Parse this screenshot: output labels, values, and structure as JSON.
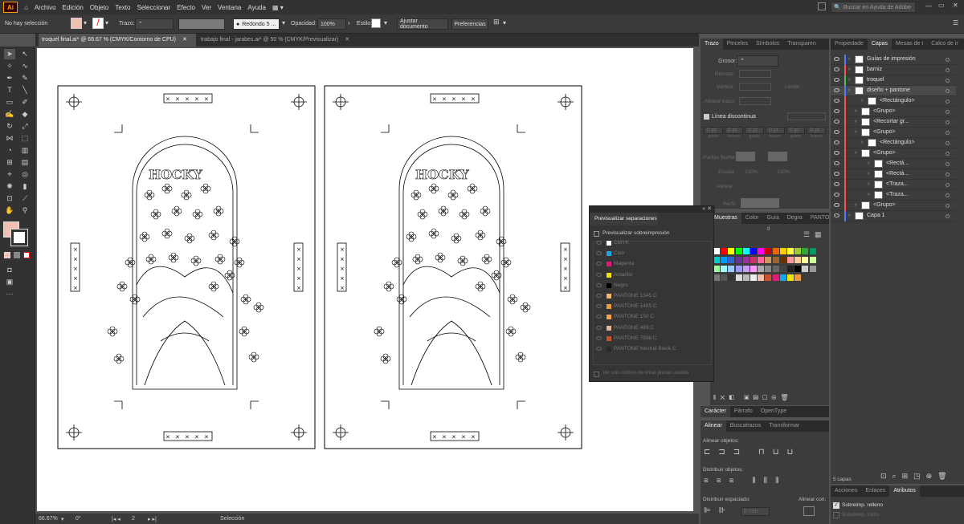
{
  "app": {
    "logo": "Ai",
    "search_placeholder": "Buscar en Ayuda de Adobe"
  },
  "menu": [
    "Archivo",
    "Edición",
    "Objeto",
    "Texto",
    "Seleccionar",
    "Efecto",
    "Ver",
    "Ventana",
    "Ayuda"
  ],
  "control": {
    "selection": "No hay selección",
    "stroke_label": "Trazo:",
    "brush": "Redondo 5 ...",
    "opacity_label": "Opacidad:",
    "opacity": "100%",
    "style_label": "Estilo:",
    "adjust_btn": "Ajustar documento",
    "prefs_btn": "Preferencias"
  },
  "tabs": [
    "troquel final.ai* @ 66.67 % (CMYK/Contorno de CPU)",
    "trabajo final - jarabes.ai* @ 50 % (CMYK/Previsualizar)"
  ],
  "status": {
    "zoom": "66.67%",
    "rotation": "0°",
    "page": "2",
    "mode": "Selección"
  },
  "stroke_panel": {
    "tabs": [
      "Trazo",
      "Pinceles",
      "Símbolos",
      "Transparen"
    ],
    "weight_label": "Grosor:",
    "cap_label": "Remate:",
    "corner_label": "Vértice:",
    "limit_label": "Límite:",
    "align_label": "Alinear trazo:",
    "dashed_label": "Línea discontinua",
    "dash_fields": [
      "0 pt",
      "0 pt",
      "0 pt",
      "0 pt",
      "0 pt",
      "0 pt"
    ],
    "dash_labels": [
      "guión",
      "hueco",
      "guión",
      "hueco",
      "guión",
      "hueco"
    ],
    "arrow_label": "Puntas flecha:",
    "scale_label": "Escala:",
    "scale1": "100%",
    "scale2": "100%",
    "align2_label": "Alinear:",
    "profile_label": "Perfil:"
  },
  "swatch_panel": {
    "tabs": [
      "Muestras",
      "Color",
      "Guía d",
      "Degra",
      "PANTO"
    ]
  },
  "separations": {
    "title": "Previsualizar separaciones",
    "overprint": "Previsualizar sobreimpresión",
    "items": [
      "CMYK",
      "Cian",
      "Magenta",
      "Amarillo",
      "Negro",
      "PANTONE 1345 C",
      "PANTONE 1485 C",
      "PANTONE 150 C",
      "PANTONE 489 C",
      "PANTONE 7598 C",
      "PANTONE Neutral Black C"
    ],
    "item_colors": [
      "#ffffff",
      "#1aa3e8",
      "#e0197a",
      "#f3e400",
      "#000000",
      "#f7b56b",
      "#f39a3d",
      "#f5a34a",
      "#e8b49a",
      "#c8522a",
      "#2a2a2a"
    ],
    "spot_only": "Ver solo colores de tintas planas usadas"
  },
  "char_panel": {
    "tabs": [
      "Carácter",
      "Párrafo",
      "OpenType"
    ]
  },
  "align_panel": {
    "tabs": [
      "Alinear",
      "Buscatrazos",
      "Transformar"
    ],
    "align_objects": "Alinear objetos:",
    "distribute_objects": "Distribuir objetos:",
    "distribute_spacing": "Distribuir espaciado:",
    "align_to": "Alinear con:",
    "spacing_value": "0 mm"
  },
  "layers_panel": {
    "tabs": [
      "Propiedade",
      "Capas",
      "Mesas de t",
      "Calco de ir"
    ],
    "count": "5 capas",
    "items": [
      {
        "name": "Guías de impresión",
        "indent": 0,
        "color": "#4f7bff"
      },
      {
        "name": "barniz",
        "indent": 0,
        "color": "#ff4f4f"
      },
      {
        "name": "troquel",
        "indent": 0,
        "color": "#4fbf4f"
      },
      {
        "name": "diseño + pantone",
        "indent": 0,
        "color": "#4f7bff",
        "selected": true
      },
      {
        "name": "<Rectángulo>",
        "indent": 2,
        "color": "#ff4f4f"
      },
      {
        "name": "<Grupo>",
        "indent": 1,
        "color": "#ff4f4f"
      },
      {
        "name": "<Recortar gr...",
        "indent": 1,
        "color": "#ff4f4f"
      },
      {
        "name": "<Grupo>",
        "indent": 1,
        "color": "#ff4f4f"
      },
      {
        "name": "<Rectángulo>",
        "indent": 2,
        "color": "#ff4f4f"
      },
      {
        "name": "<Grupo>",
        "indent": 1,
        "color": "#ff4f4f"
      },
      {
        "name": "<Rectá...",
        "indent": 3,
        "color": "#ff4f4f"
      },
      {
        "name": "<Rectá...",
        "indent": 3,
        "color": "#ff4f4f"
      },
      {
        "name": "<Traza...",
        "indent": 3,
        "color": "#ff4f4f"
      },
      {
        "name": "<Traza...",
        "indent": 3,
        "color": "#ff4f4f"
      },
      {
        "name": "<Grupo>",
        "indent": 1,
        "color": "#ff4f4f"
      },
      {
        "name": "Capa 1",
        "indent": 0,
        "color": "#4f7bff"
      }
    ]
  },
  "attr_panel": {
    "tabs": [
      "Acciones",
      "Enlaces",
      "Atributos"
    ],
    "overprint_fill": "Sobreimp. relleno",
    "overprint_stroke": "Sobreimp. trazo"
  },
  "artboard": {
    "logo_text": "HOCKY",
    "reg_labels": [
      "×",
      "×",
      "×",
      "×",
      "×"
    ]
  },
  "colors": {
    "ui_bg": "#535353",
    "panel": "#3c3c3c",
    "accent": "#4f7bff",
    "fill": "#f0c0b0"
  }
}
